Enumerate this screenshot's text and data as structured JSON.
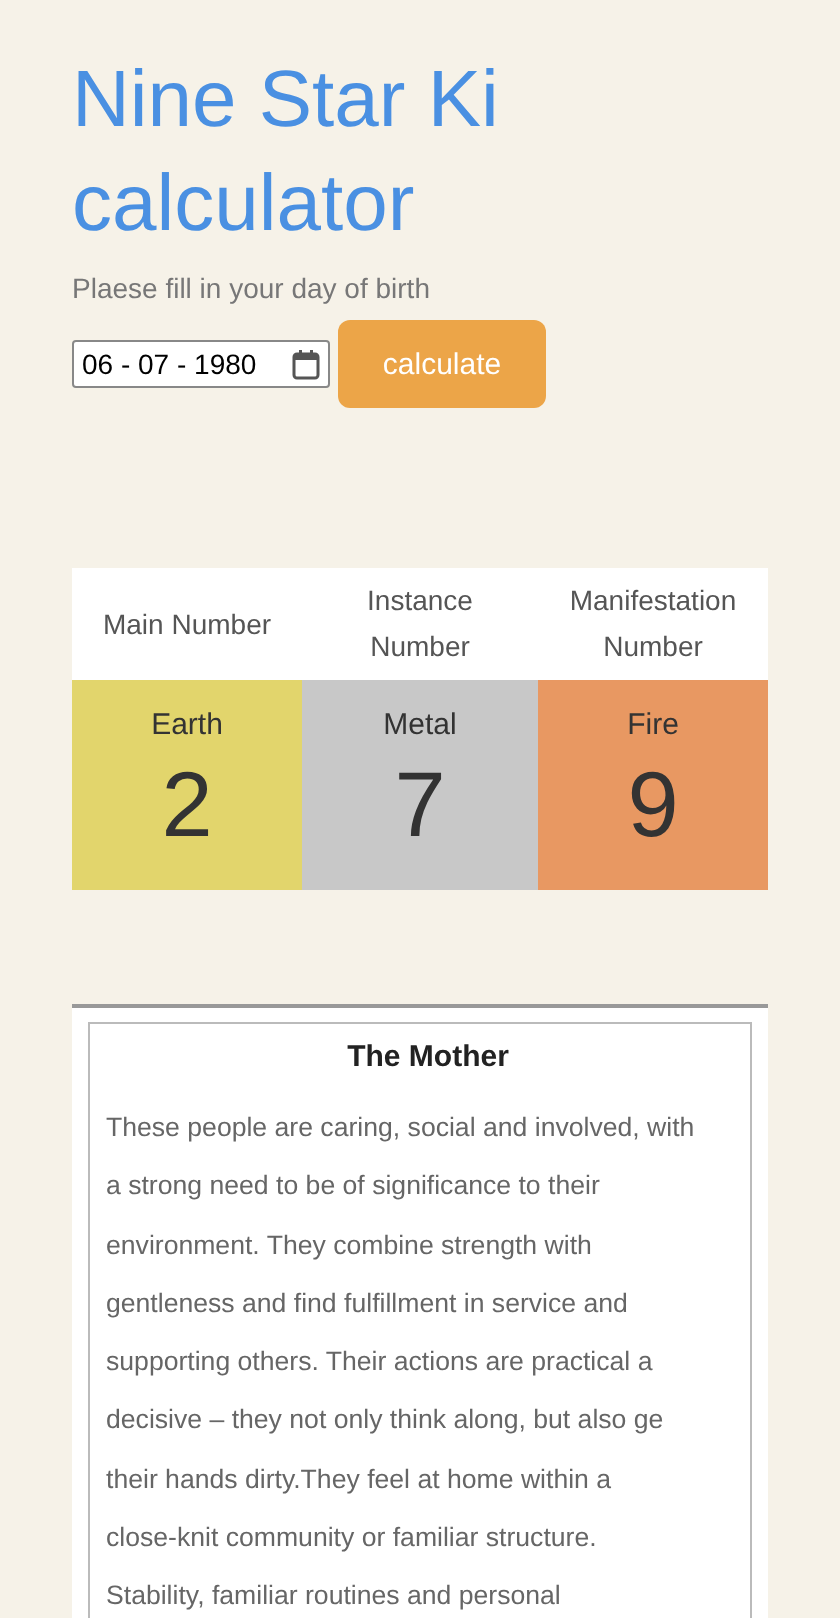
{
  "title": "Nine Star Ki calculator",
  "form": {
    "label": "Plaese fill in your day of birth",
    "date_value": "06 - 07 - 1980",
    "button": "calculate"
  },
  "numbers": [
    {
      "heading": "Main Number",
      "element": "Earth",
      "value": "2",
      "color": "#e2d56c"
    },
    {
      "heading": "Instance Number",
      "element": "Metal",
      "value": "7",
      "color": "#c8c8c8"
    },
    {
      "heading": "Manifestation Number",
      "element": "Fire",
      "value": "9",
      "color": "#e89862"
    }
  ],
  "description": {
    "title": "The Mother",
    "lines": [
      "These people are caring, social and involved, with",
      "a strong need to be of significance to their",
      "environment. They combine strength with",
      "gentleness and find fulfillment in service and",
      "supporting others. Their actions are practical a",
      "decisive – they not only think along, but also ge",
      "their hands dirty.They feel at home within a",
      "close-knit community or familiar structure.",
      "Stability, familiar routines and personal"
    ]
  }
}
